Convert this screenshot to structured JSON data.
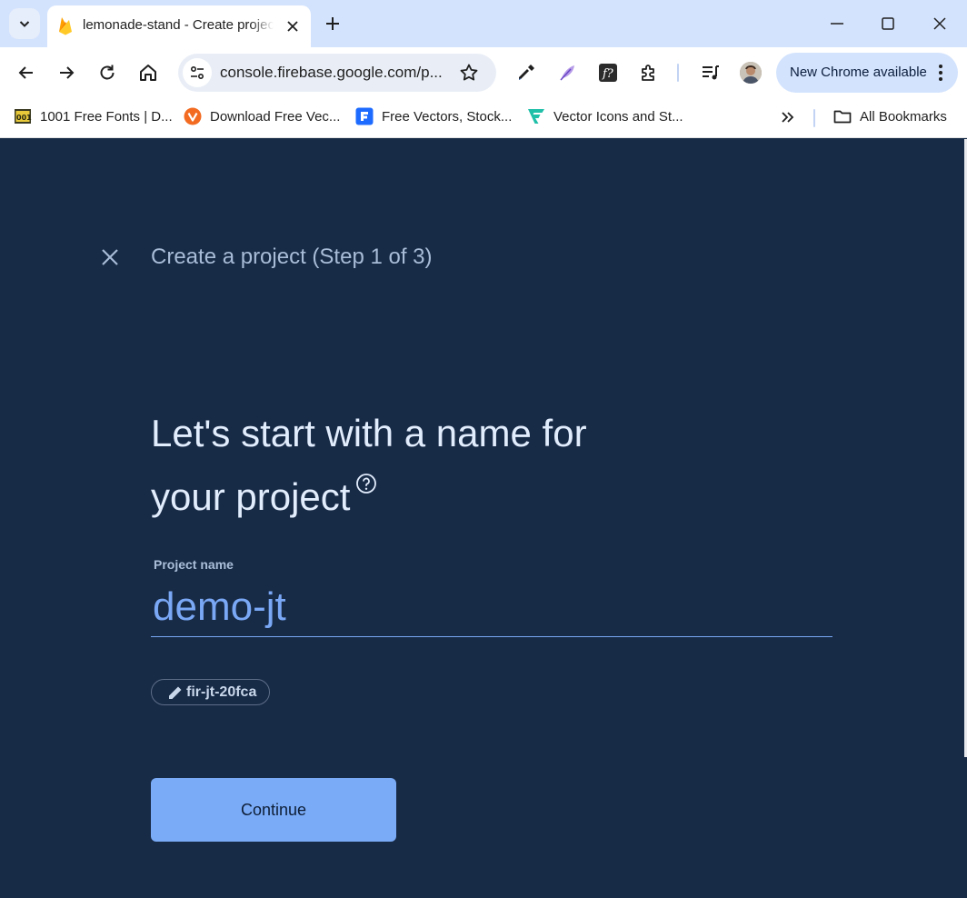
{
  "browser": {
    "tab": {
      "title": "lemonade-stand - Create project"
    },
    "url": "console.firebase.google.com/p...",
    "update_chip": "New Chrome available",
    "bookmarks": [
      {
        "label": "1001 Free Fonts | D...",
        "icon": "fonts-icon"
      },
      {
        "label": "Download Free Vec...",
        "icon": "vecteezy-icon"
      },
      {
        "label": "Free Vectors, Stock...",
        "icon": "freepik-icon"
      },
      {
        "label": "Vector Icons and St...",
        "icon": "flaticon-icon"
      }
    ],
    "all_bookmarks": "All Bookmarks",
    "colors": {
      "frame": "#d3e3fd",
      "omnibox": "#e9eef6"
    }
  },
  "page": {
    "step_title": "Create a project (Step 1 of 3)",
    "heading_line1": "Let's start with a name for",
    "heading_line2": "your project",
    "field_label": "Project name",
    "project_name": "demo-jt",
    "project_id": "fir-jt-20fca",
    "continue_label": "Continue",
    "colors": {
      "background": "#172a46",
      "accent": "#7aabf7",
      "heading": "#e1ecfc"
    }
  }
}
